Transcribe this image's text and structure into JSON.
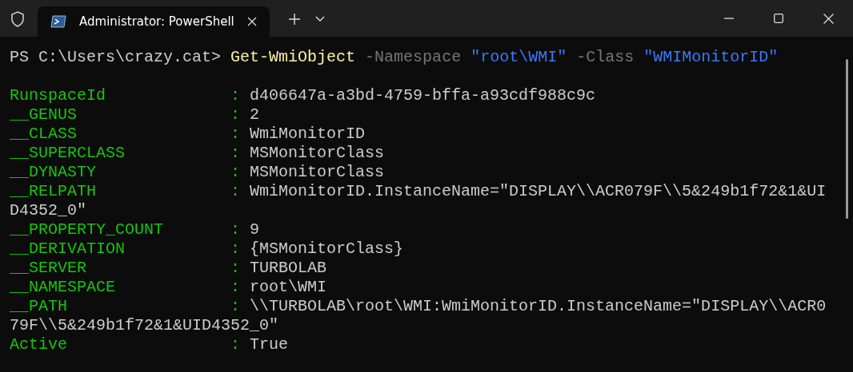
{
  "window": {
    "tab_title": "Administrator: PowerShell"
  },
  "command": [
    {
      "kind": "prompt",
      "text": "PS C:\\Users\\crazy.cat>"
    },
    {
      "kind": "cmdlet",
      "text": "Get-WmiObject"
    },
    {
      "kind": "parameter",
      "text": "-Namespace"
    },
    {
      "kind": "string",
      "text": "\"root\\WMI\""
    },
    {
      "kind": "parameter",
      "text": "-Class"
    },
    {
      "kind": "string",
      "text": "\"WMIMonitorID\""
    }
  ],
  "properties": [
    {
      "name": "RunspaceId",
      "separator": ":",
      "value_lines": [
        "d406647a-a3bd-4759-bffa-a93cdf988c9c"
      ]
    },
    {
      "name": "__GENUS",
      "separator": ":",
      "value_lines": [
        "2"
      ]
    },
    {
      "name": "__CLASS",
      "separator": ":",
      "value_lines": [
        "WmiMonitorID"
      ]
    },
    {
      "name": "__SUPERCLASS",
      "separator": ":",
      "value_lines": [
        "MSMonitorClass"
      ]
    },
    {
      "name": "__DYNASTY",
      "separator": ":",
      "value_lines": [
        "MSMonitorClass"
      ]
    },
    {
      "name": "__RELPATH",
      "separator": ":",
      "value_lines": [
        "WmiMonitorID.InstanceName=\"DISPLAY\\\\ACR079F\\\\5&249b1f72&1&UI",
        "D4352_0\""
      ]
    },
    {
      "name": "__PROPERTY_COUNT",
      "separator": ":",
      "value_lines": [
        "9"
      ]
    },
    {
      "name": "__DERIVATION",
      "separator": ":",
      "value_lines": [
        "{MSMonitorClass}"
      ]
    },
    {
      "name": "__SERVER",
      "separator": ":",
      "value_lines": [
        "TURBOLAB"
      ]
    },
    {
      "name": "__NAMESPACE",
      "separator": ":",
      "value_lines": [
        "root\\WMI"
      ]
    },
    {
      "name": "__PATH",
      "separator": ":",
      "value_lines": [
        "\\\\TURBOLAB\\root\\WMI:WmiMonitorID.InstanceName=\"DISPLAY\\\\ACR0",
        "79F\\\\5&249b1f72&1&UID4352_0\""
      ]
    },
    {
      "name": "Active",
      "separator": ":",
      "value_lines": [
        "True"
      ]
    }
  ]
}
